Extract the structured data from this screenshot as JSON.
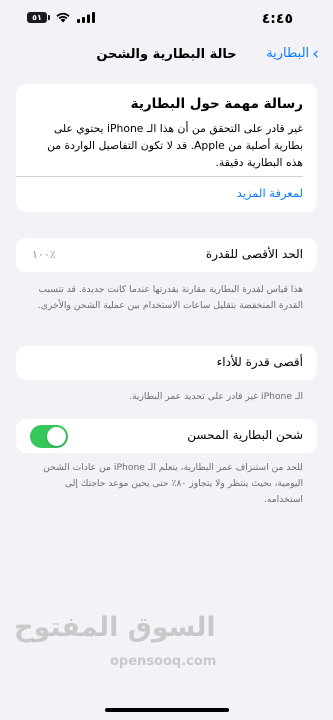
{
  "status_bar": {
    "time": "٤:٤٥",
    "battery_level": "٥١",
    "icons": [
      "battery-icon",
      "wifi-icon",
      "signal-icon"
    ]
  },
  "nav": {
    "back_label": "البطارية",
    "title": "حالة البطارية والشحن"
  },
  "message": {
    "title": "رسالة مهمة حول البطارية",
    "body": "غير قادر على التحقق من أن هذا الـ iPhone يحتوي على بطارية أصلية من Apple. قد لا تكون التفاصيل الواردة من هذه البطارية دقيقة.",
    "link": "لمعرفة المزيد"
  },
  "max_capacity": {
    "label": "الحد الأقصى للقدرة",
    "value": "٪١٠٠",
    "footer": "هذا قياس لقدرة البطارية مقارنة بقدرتها عندما كانت جديدة. قد تتسبب القدرة المنخفضة بتقليل ساعات الاستخدام بين عملية الشحن والأخرى."
  },
  "peak_performance": {
    "label": "أقصى قدرة للأداء",
    "footer": "الـ iPhone غير قادر على تحديد عمر البطارية."
  },
  "optimized_charging": {
    "label": "شحن البطارية المحسن",
    "enabled": true,
    "footer": "للحد من استنزاف عمر البطارية، يتعلم الـ iPhone من عادات الشحن اليومية، بحيث ينتظر ولا يتجاوز ٨٠٪ حتى يحين موعد حاجتك إلى استخدامه."
  },
  "watermark": {
    "arabic": "السوق المفتوح",
    "latin": "opensooq.com"
  },
  "colors": {
    "accent": "#0a7aff",
    "toggle_on": "#34c759",
    "background": "#f2f2f7"
  }
}
